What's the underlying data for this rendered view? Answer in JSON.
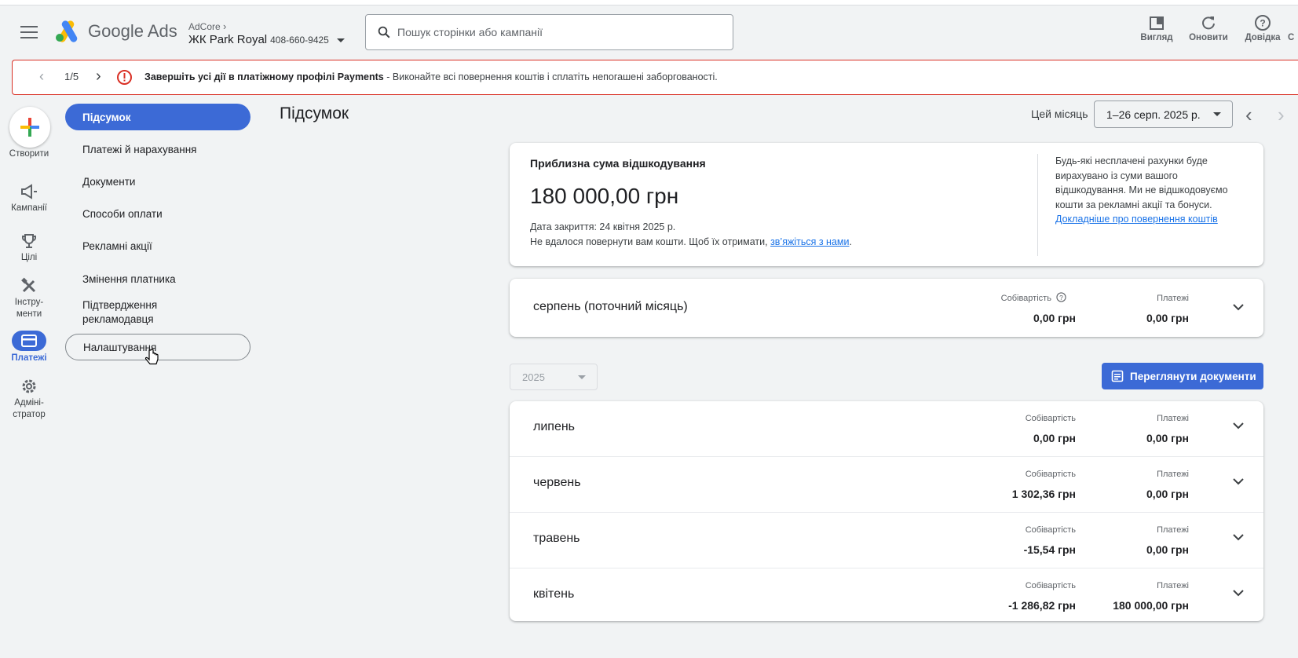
{
  "header": {
    "brand": "Google Ads",
    "account_parent": "AdCore",
    "account_name": "ЖК Park Royal",
    "account_id": "408-660-9425",
    "search_placeholder": "Пошук сторінки або кампанії",
    "tools": [
      {
        "label": "Вигляд",
        "icon": "appearance-icon"
      },
      {
        "label": "Оновити",
        "icon": "refresh-icon"
      },
      {
        "label": "Довідка",
        "icon": "help-icon"
      },
      {
        "label": "С",
        "icon": "notifications-icon"
      }
    ]
  },
  "banner": {
    "page": "1/5",
    "bold": "Завершіть усі дії в платіжному профілі Payments",
    "text": " - Виконайте всі повернення коштів і сплатіть непогашені заборгованості."
  },
  "rail": {
    "create": "Створити",
    "items": [
      {
        "label": "Кампанії",
        "icon": "campaigns-icon"
      },
      {
        "label": "Цілі",
        "icon": "goals-icon"
      },
      {
        "label": "Інстру-\nменти",
        "icon": "tools-icon"
      },
      {
        "label": "Платежі",
        "icon": "billing-icon"
      },
      {
        "label": "Адміні-\nстратор",
        "icon": "admin-icon"
      }
    ]
  },
  "subnav": {
    "items": [
      "Підсумок",
      "Платежі й нарахування",
      "Документи",
      "Способи оплати",
      "Рекламні акції",
      "Змінення платника",
      "Підтвердження рекламодавця",
      "Налаштування"
    ]
  },
  "main": {
    "title": "Підсумок",
    "period_label": "Цей місяць",
    "date_range": "1–26 серп. 2025 р.",
    "refund": {
      "title": "Приблизна сума відшкодування",
      "amount": "180 000,00 грн",
      "close_date": "Дата закриття: 24 квітня 2025 р.",
      "fail_text": "Не вдалося повернути вам кошти. Щоб їх отримати, ",
      "contact_link": "зв’яжіться з нами",
      "period": ".",
      "side_text": "Будь-які несплачені рахунки буде вирахувано із суми вашого відшкодування. Ми не відшкодовуємо кошти за рекламні акції та бонуси.",
      "side_link": "Докладніше про повернення коштів"
    },
    "current_month": {
      "name": "серпень (поточний місяць)",
      "cost_label": "Собівартість",
      "cost": "0,00 грн",
      "pay_label": "Платежі",
      "pay": "0,00 грн"
    },
    "year": "2025",
    "docs_button": "Переглянути документи",
    "months": [
      {
        "name": "липень",
        "cost_label": "Собівартість",
        "cost": "0,00 грн",
        "pay_label": "Платежі",
        "pay": "0,00 грн"
      },
      {
        "name": "червень",
        "cost_label": "Собівартість",
        "cost": "1 302,36 грн",
        "pay_label": "Платежі",
        "pay": "0,00 грн"
      },
      {
        "name": "травень",
        "cost_label": "Собівартість",
        "cost": "-15,54 грн",
        "pay_label": "Платежі",
        "pay": "0,00 грн"
      },
      {
        "name": "квітень",
        "cost_label": "Собівартість",
        "cost": "-1 286,82 грн",
        "pay_label": "Платежі",
        "pay": "180 000,00 грн"
      }
    ]
  },
  "colors": {
    "accent": "#3c6ad6",
    "error": "#d93025",
    "link": "#1a73e8"
  }
}
